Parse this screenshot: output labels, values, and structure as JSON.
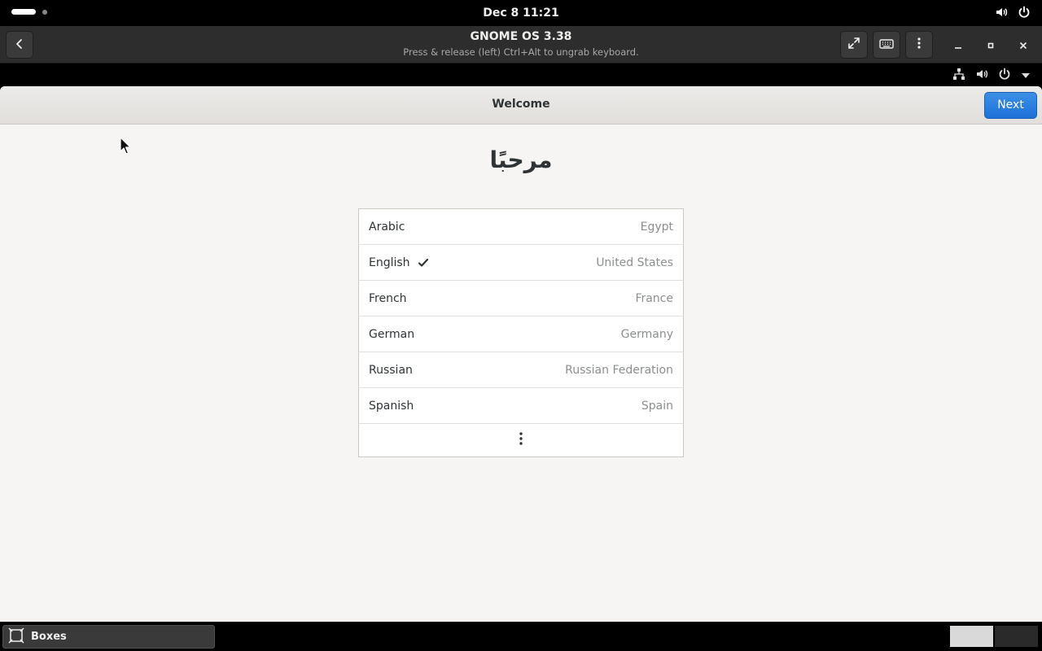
{
  "topbar": {
    "clock": "Dec 8  11:21",
    "icons": [
      "volume-icon",
      "power-icon"
    ]
  },
  "boxes": {
    "title": "GNOME OS 3.38",
    "subtitle": "Press & release (left) Ctrl+Alt to ungrab keyboard.",
    "icons": [
      "back-icon",
      "fullscreen-icon",
      "keyboard-icon",
      "menu-dots-icon",
      "minimize-icon",
      "maximize-icon",
      "close-icon"
    ]
  },
  "guest_panel": {
    "icons": [
      "network-icon",
      "volume-icon",
      "power-icon",
      "dropdown-arrow-icon"
    ]
  },
  "welcome": {
    "title": "Welcome",
    "next_label": "Next",
    "greeting": "مرحبًا",
    "languages": [
      {
        "name": "Arabic",
        "region": "Egypt",
        "selected": false
      },
      {
        "name": "English",
        "region": "United States",
        "selected": true
      },
      {
        "name": "French",
        "region": "France",
        "selected": false
      },
      {
        "name": "German",
        "region": "Germany",
        "selected": false
      },
      {
        "name": "Russian",
        "region": "Russian Federation",
        "selected": false
      },
      {
        "name": "Spanish",
        "region": "Spain",
        "selected": false
      }
    ],
    "more_icon": "more-vertical-icon"
  },
  "taskbar": {
    "app_label": "Boxes",
    "app_icon": "boxes-icon"
  },
  "colors": {
    "accent": "#1c71d8",
    "background": "#f6f5f4"
  }
}
